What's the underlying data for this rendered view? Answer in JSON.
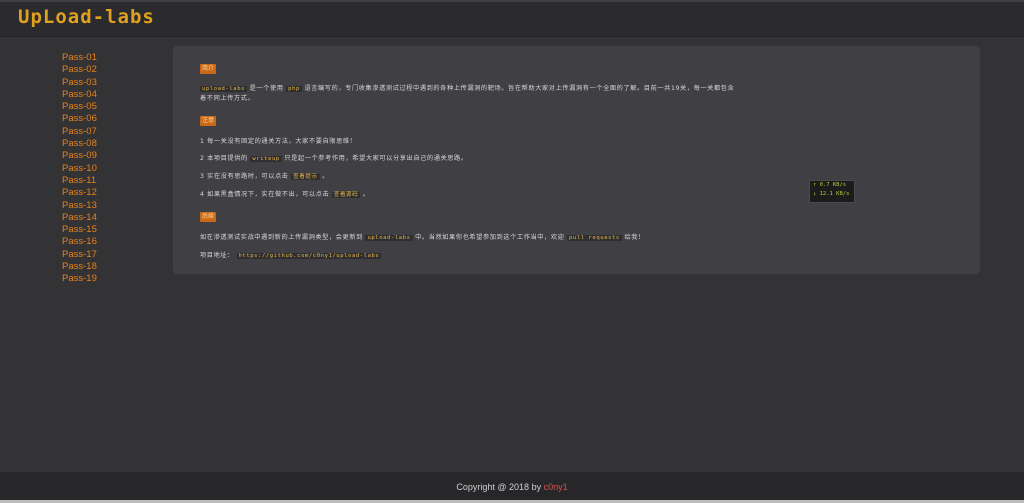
{
  "header": {
    "logo": "UpLoad-labs"
  },
  "sidebar": {
    "items": [
      "Pass-01",
      "Pass-02",
      "Pass-03",
      "Pass-04",
      "Pass-05",
      "Pass-06",
      "Pass-07",
      "Pass-08",
      "Pass-09",
      "Pass-10",
      "Pass-11",
      "Pass-12",
      "Pass-13",
      "Pass-14",
      "Pass-15",
      "Pass-16",
      "Pass-17",
      "Pass-18",
      "Pass-19"
    ]
  },
  "main": {
    "section1_tag": "简介",
    "intro_code": "upload-labs",
    "intro_a": "是一个使用",
    "intro_lang": "php",
    "intro_b": "语言编写的，专门收集渗透测试过程中遇到的各种上传漏洞的靶场。旨在帮助大家对上传漏洞有一个全面的了解。目前一共19关，每一关都包含",
    "intro_c": "着不同上传方式。",
    "section2_tag": "注意",
    "note1": "1  每一关没有固定的通关方法，大家不要自限思维！",
    "note2_a": "2  本项目提供的",
    "note2_code": "writeup",
    "note2_b": "只是起一个参考作用，希望大家可以分享出自己的通关思路。",
    "note3_a": "3  实在没有思路时，可以点击",
    "note3_code": "查看提示",
    "note3_b": "。",
    "note4_a": "4  如果黑盒情况下，实在做不出，可以点击",
    "note4_code": "查看源码",
    "note4_b": "。",
    "section3_tag": "后续",
    "follow_a": "如在渗透测试实战中遇到新的上传漏洞类型，会更新到",
    "follow_code": "upload-labs",
    "follow_b": "中。当然如果你也希望参加到这个工作当中，欢迎",
    "follow_code2": "pull requests",
    "follow_c": "给我！",
    "project_label": "项目地址：",
    "project_url": "https://github.com/c0ny1/upload-labs"
  },
  "netspeed": {
    "up": "↑ 0.7 KB/s",
    "down": "↓ 12.1 KB/s"
  },
  "footer": {
    "copyright": "Copyright @ 2018 by ",
    "author": "c0ny1"
  }
}
